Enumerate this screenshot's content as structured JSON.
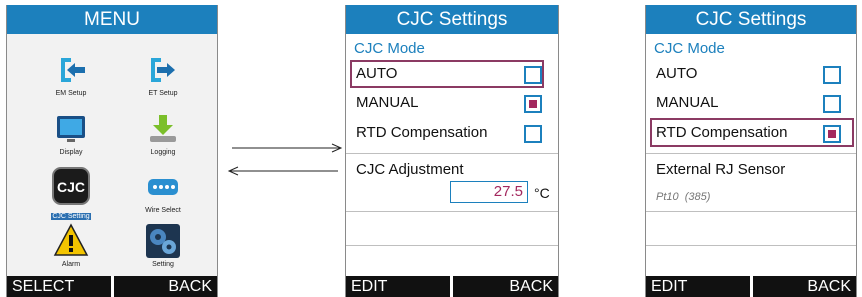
{
  "menu": {
    "title": "MENU",
    "items": [
      {
        "label": "EM Setup",
        "icon": "arrow-left-bracket-icon"
      },
      {
        "label": "ET Setup",
        "icon": "arrow-right-bracket-icon"
      },
      {
        "label": "Display",
        "icon": "monitor-icon"
      },
      {
        "label": "Logging",
        "icon": "download-tray-icon"
      },
      {
        "label": "CJC Setting",
        "icon": "cjc-icon"
      },
      {
        "label": "Wire Select",
        "icon": "connector-icon"
      },
      {
        "label": "Alarm",
        "icon": "warning-icon"
      },
      {
        "label": "Setting",
        "icon": "gears-icon"
      }
    ],
    "softkeys": {
      "left": "SELECT",
      "right": "BACK"
    }
  },
  "cjc1": {
    "title": "CJC Settings",
    "mode_header": "CJC Mode",
    "options": [
      {
        "label": "AUTO",
        "checked": false
      },
      {
        "label": "MANUAL",
        "checked": true
      },
      {
        "label": "RTD Compensation",
        "checked": false
      }
    ],
    "adjust_label": "CJC Adjustment",
    "adjust_value": "27.5",
    "adjust_unit": "°C",
    "softkeys": {
      "left": "EDIT",
      "right": "BACK"
    }
  },
  "cjc2": {
    "title": "CJC Settings",
    "mode_header": "CJC Mode",
    "options": [
      {
        "label": "AUTO",
        "checked": false
      },
      {
        "label": "MANUAL",
        "checked": false
      },
      {
        "label": "RTD Compensation",
        "checked": true
      }
    ],
    "sensor_label": "External RJ Sensor",
    "sensor_value": "Pt10  (385)",
    "softkeys": {
      "left": "EDIT",
      "right": "BACK"
    }
  },
  "colors": {
    "title_bar": "#1c80bd",
    "highlight": "#8b3a63",
    "check_fill": "#a3285e"
  }
}
